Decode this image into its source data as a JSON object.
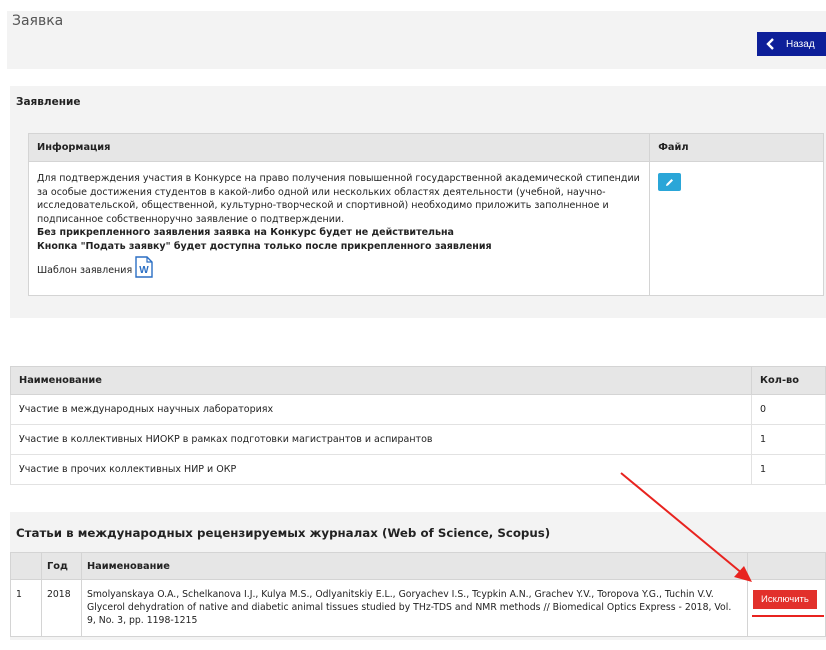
{
  "header": {
    "title": "Заявка",
    "back_label": "Назад"
  },
  "application_panel": {
    "title": "Заявление",
    "columns": [
      "Информация",
      "Файл"
    ],
    "info_text": "Для подтверждения участия в Конкурсе на право получения повышенной государственной академической стипендии за особые достижения студентов в какой-либо одной или нескольких областях деятельности (учебной, научно-исследовательской, общественной, культурно-творческой и спортивной) необходимо приложить заполненное и подписанное собственноручно заявление о подтверждении.",
    "warning_1": "Без прикрепленного заявления заявка на Конкурс будет не действительна",
    "warning_2": "Кнопка \"Подать заявку\" будет доступна только после прикрепленного заявления",
    "template_label": "Шаблон заявления",
    "word_icon_letter": "W"
  },
  "counts": {
    "columns": [
      "Наименование",
      "Кол-во"
    ],
    "rows": [
      {
        "name": "Участие в международных научных лабораториях",
        "count": "0"
      },
      {
        "name": "Участие в коллективных НИОКР в рамках подготовки магистрантов и аспирантов",
        "count": "1"
      },
      {
        "name": "Участие в прочих коллективных НИР и ОКР",
        "count": "1"
      }
    ]
  },
  "articles": {
    "title": "Статьи в международных рецензируемых журналах (Web of Science, Scopus)",
    "columns": [
      "",
      "Год",
      "Наименование",
      ""
    ],
    "rows": [
      {
        "num": "1",
        "year": "2018",
        "name": "Smolyanskaya O.A., Schelkanova I.J., Kulya M.S., Odlyanitskiy E.L., Goryachev I.S., Tcypkin A.N., Grachev Y.V., Toropova Y.G., Tuchin V.V. Glycerol dehydration of native and diabetic animal tissues studied by THz-TDS and NMR methods // Biomedical Optics Express - 2018, Vol. 9, No. 3, pp. 1198-1215",
        "action": "Исключить"
      }
    ]
  },
  "colors": {
    "back_button": "#0d1f99",
    "edit_button": "#2aa6d8",
    "exclude_button": "#e2302b",
    "annotation": "#e8231f"
  }
}
